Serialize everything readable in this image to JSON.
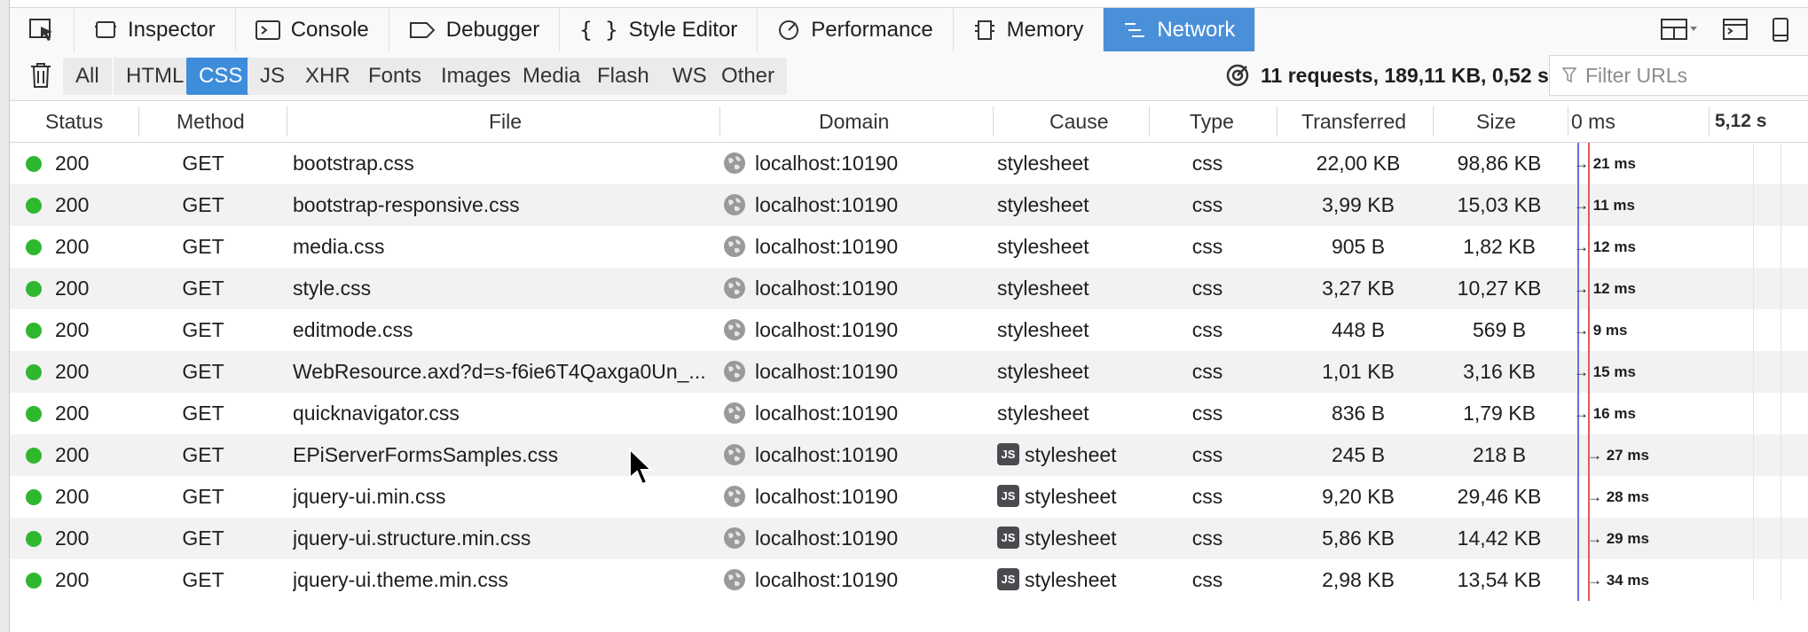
{
  "tabs": [
    {
      "label": "Inspector",
      "icon": "inspector-icon"
    },
    {
      "label": "Console",
      "icon": "console-icon"
    },
    {
      "label": "Debugger",
      "icon": "debugger-icon"
    },
    {
      "label": "Style Editor",
      "icon": "style-editor-icon"
    },
    {
      "label": "Performance",
      "icon": "performance-icon"
    },
    {
      "label": "Memory",
      "icon": "memory-icon"
    },
    {
      "label": "Network",
      "icon": "network-icon"
    }
  ],
  "active_tab": "Network",
  "filters": [
    "All",
    "HTML",
    "CSS",
    "JS",
    "XHR",
    "Fonts",
    "Images",
    "Media",
    "Flash",
    "WS",
    "Other"
  ],
  "active_filter": "CSS",
  "summary": "11 requests, 189,11 KB, 0,52 s",
  "filter_placeholder": "Filter URLs",
  "columns": {
    "status": "Status",
    "method": "Method",
    "file": "File",
    "domain": "Domain",
    "cause": "Cause",
    "type": "Type",
    "transferred": "Transferred",
    "size": "Size",
    "wf_start": "0 ms",
    "wf_end": "5,12 s"
  },
  "requests": [
    {
      "status": "200",
      "method": "GET",
      "file": "bootstrap.css",
      "domain": "localhost:10190",
      "cause": "stylesheet",
      "js": false,
      "type": "css",
      "transferred": "22,00 KB",
      "size": "98,86 KB",
      "timing": "21 ms"
    },
    {
      "status": "200",
      "method": "GET",
      "file": "bootstrap-responsive.css",
      "domain": "localhost:10190",
      "cause": "stylesheet",
      "js": false,
      "type": "css",
      "transferred": "3,99 KB",
      "size": "15,03 KB",
      "timing": "11 ms"
    },
    {
      "status": "200",
      "method": "GET",
      "file": "media.css",
      "domain": "localhost:10190",
      "cause": "stylesheet",
      "js": false,
      "type": "css",
      "transferred": "905 B",
      "size": "1,82 KB",
      "timing": "12 ms"
    },
    {
      "status": "200",
      "method": "GET",
      "file": "style.css",
      "domain": "localhost:10190",
      "cause": "stylesheet",
      "js": false,
      "type": "css",
      "transferred": "3,27 KB",
      "size": "10,27 KB",
      "timing": "12 ms"
    },
    {
      "status": "200",
      "method": "GET",
      "file": "editmode.css",
      "domain": "localhost:10190",
      "cause": "stylesheet",
      "js": false,
      "type": "css",
      "transferred": "448 B",
      "size": "569 B",
      "timing": "9 ms"
    },
    {
      "status": "200",
      "method": "GET",
      "file": "WebResource.axd?d=s-f6ie6T4Qaxga0Un_...",
      "domain": "localhost:10190",
      "cause": "stylesheet",
      "js": false,
      "type": "css",
      "transferred": "1,01 KB",
      "size": "3,16 KB",
      "timing": "15 ms"
    },
    {
      "status": "200",
      "method": "GET",
      "file": "quicknavigator.css",
      "domain": "localhost:10190",
      "cause": "stylesheet",
      "js": false,
      "type": "css",
      "transferred": "836 B",
      "size": "1,79 KB",
      "timing": "16 ms"
    },
    {
      "status": "200",
      "method": "GET",
      "file": "EPiServerFormsSamples.css",
      "domain": "localhost:10190",
      "cause": "stylesheet",
      "js": true,
      "type": "css",
      "transferred": "245 B",
      "size": "218 B",
      "timing": "27 ms"
    },
    {
      "status": "200",
      "method": "GET",
      "file": "jquery-ui.min.css",
      "domain": "localhost:10190",
      "cause": "stylesheet",
      "js": true,
      "type": "css",
      "transferred": "9,20 KB",
      "size": "29,46 KB",
      "timing": "28 ms"
    },
    {
      "status": "200",
      "method": "GET",
      "file": "jquery-ui.structure.min.css",
      "domain": "localhost:10190",
      "cause": "stylesheet",
      "js": true,
      "type": "css",
      "transferred": "5,86 KB",
      "size": "14,42 KB",
      "timing": "29 ms"
    },
    {
      "status": "200",
      "method": "GET",
      "file": "jquery-ui.theme.min.css",
      "domain": "localhost:10190",
      "cause": "stylesheet",
      "js": true,
      "type": "css",
      "transferred": "2,98 KB",
      "size": "13,54 KB",
      "timing": "34 ms"
    }
  ],
  "colors": {
    "accent": "#4a90d9",
    "status_ok": "#2fb82f",
    "dom_line": "#6a6fe0",
    "load_line": "#e05a5a"
  },
  "js_badge": "JS"
}
